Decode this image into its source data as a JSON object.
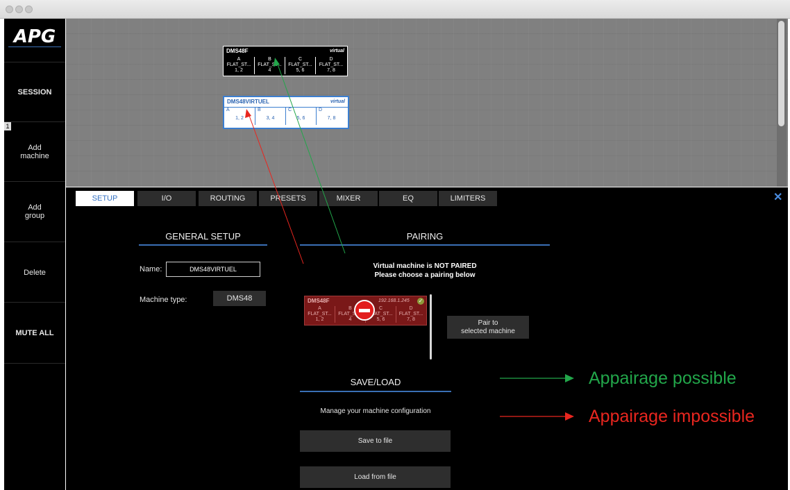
{
  "sidebar": {
    "logo": "APG",
    "items": [
      {
        "label": "SESSION"
      },
      {
        "label": "Add\nmachine"
      },
      {
        "label": "Add\ngroup"
      },
      {
        "label": "Delete"
      },
      {
        "label": "MUTE ALL"
      }
    ],
    "badge": "1"
  },
  "canvas": {
    "machine1": {
      "name": "DMS48F",
      "tag": "virtual",
      "cells": [
        {
          "ch": "A",
          "val": "FLAT_ST...",
          "sub": "1, 2"
        },
        {
          "ch": "B",
          "val": "FLAT_ST...",
          "sub": "4"
        },
        {
          "ch": "C",
          "val": "FLAT_ST...",
          "sub": "5, 6"
        },
        {
          "ch": "D",
          "val": "FLAT_ST...",
          "sub": "7, 8"
        }
      ]
    },
    "machine2": {
      "name": "DMS48VIRTUEL",
      "tag": "virtual",
      "cells": [
        {
          "ch": "A",
          "sub": "1, 2"
        },
        {
          "ch": "B",
          "sub": "3, 4"
        },
        {
          "ch": "C",
          "sub": "5, 6"
        },
        {
          "ch": "D",
          "sub": "7, 8"
        }
      ]
    }
  },
  "tabs": [
    "SETUP",
    "I/O",
    "ROUTING",
    "PRESETS",
    "MIXER",
    "EQ",
    "LIMITERS"
  ],
  "general_setup": {
    "title": "GENERAL SETUP",
    "name_label": "Name:",
    "name_value": "DMS48VIRTUEL",
    "type_label": "Machine type:",
    "type_value": "DMS48"
  },
  "pairing": {
    "title": "PAIRING",
    "message_line1": "Virtual machine is NOT PAIRED",
    "message_line2": "Please choose a pairing below",
    "list_machine": {
      "name": "DMS48F",
      "ip": "192.168.1.245",
      "cells": [
        {
          "ch": "A",
          "val": "FLAT_ST...",
          "sub": "1, 2"
        },
        {
          "ch": "B",
          "val": "FLAT_ST...",
          "sub": "4"
        },
        {
          "ch": "C",
          "val": "FLAT_ST...",
          "sub": "5, 6"
        },
        {
          "ch": "D",
          "val": "FLAT_ST...",
          "sub": "7, 8"
        }
      ]
    },
    "pair_button": "Pair to\nselected machine"
  },
  "save_load": {
    "title": "SAVE/LOAD",
    "description": "Manage your machine configuration",
    "save_button": "Save to file",
    "load_button": "Load from file"
  },
  "legend": {
    "possible": "Appairage possible",
    "impossible": "Appairage impossible",
    "possible_color": "#22a64a",
    "impossible_color": "#e8261f"
  },
  "colors": {
    "accent": "#3b7ed0",
    "panel": "#000000",
    "canvas": "#808080"
  }
}
